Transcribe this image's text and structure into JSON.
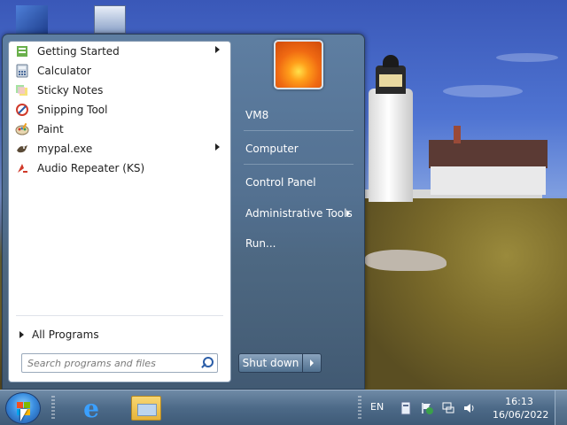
{
  "start_menu": {
    "programs": [
      {
        "label": "Getting Started",
        "icon": "getting-started-icon",
        "has_submenu": true
      },
      {
        "label": "Calculator",
        "icon": "calculator-icon",
        "has_submenu": false
      },
      {
        "label": "Sticky Notes",
        "icon": "sticky-notes-icon",
        "has_submenu": false
      },
      {
        "label": "Snipping Tool",
        "icon": "scissors-icon",
        "has_submenu": false
      },
      {
        "label": "Paint",
        "icon": "paint-palette-icon",
        "has_submenu": false
      },
      {
        "label": "mypal.exe",
        "icon": "mypal-icon",
        "has_submenu": true
      },
      {
        "label": "Audio Repeater (KS)",
        "icon": "audio-repeater-icon",
        "has_submenu": false
      }
    ],
    "all_programs_label": "All Programs",
    "search_placeholder": "Search programs and files",
    "right_items": [
      {
        "label": "VM8"
      },
      {
        "label": "Computer"
      },
      {
        "label": "Control Panel"
      },
      {
        "label": "Administrative Tools"
      },
      {
        "label": "Run..."
      }
    ],
    "shutdown_label": "Shut down"
  },
  "taskbar": {
    "language": "EN",
    "time": "16:13",
    "date": "16/06/2022"
  },
  "colors": {
    "taskbar": "#4d6a88",
    "start_menu_right": "#5a7a9a",
    "accent_blue": "#2c5ea8"
  }
}
